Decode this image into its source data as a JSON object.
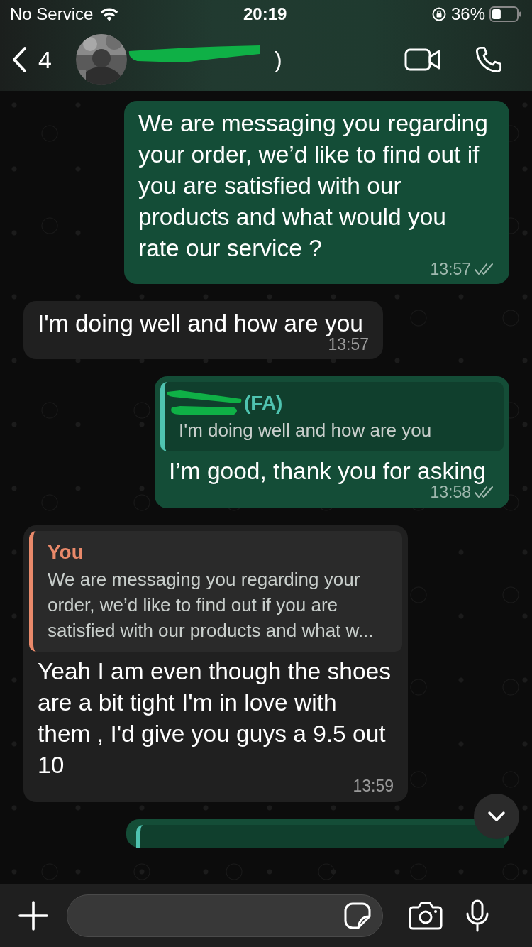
{
  "status_bar": {
    "carrier": "No Service",
    "time": "20:19",
    "battery": "36%"
  },
  "header": {
    "back_count": "4",
    "contact_name": ")"
  },
  "messages": [
    {
      "kind": "outgoing",
      "text": "We are messaging you regarding your order, we’d like to find out if you are satisfied with our products and what would you rate our service ?",
      "time": "13:57",
      "read": true
    },
    {
      "kind": "incoming",
      "text": "I'm doing well and how are you",
      "time": "13:57"
    },
    {
      "kind": "outgoing",
      "quote": {
        "author": "(FA)",
        "text": "I'm doing well and how are you",
        "color": "#4fc3b0",
        "redacted": true
      },
      "text": "I’m good, thank you for asking",
      "time": "13:58",
      "read": true
    },
    {
      "kind": "incoming",
      "quote": {
        "author": "You",
        "text": "We are messaging you regarding your order, we’d like to find out if you are satisfied with our products and what w...",
        "color": "#e9896a",
        "redacted": false
      },
      "text": "Yeah I am even though the shoes are a bit tight I'm in love with them , I'd give you guys a 9.5 out 10",
      "time": "13:59"
    },
    {
      "kind": "cut"
    }
  ]
}
